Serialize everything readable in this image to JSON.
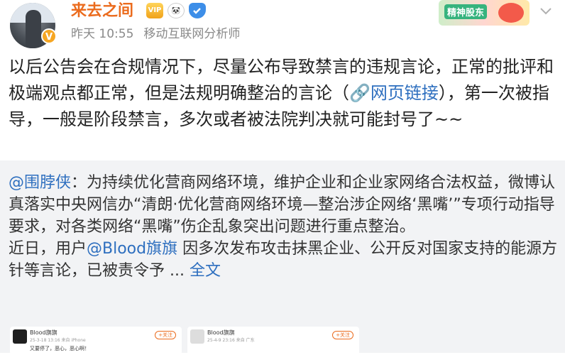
{
  "header": {
    "username": "来去之间",
    "verified_badge": "V",
    "badges": [
      {
        "name": "vip-badge",
        "label": "VIP"
      },
      {
        "name": "panda-badge",
        "label": "🐼"
      },
      {
        "name": "shield-badge",
        "label": ""
      }
    ],
    "time": "昨天 10:55",
    "source": "移动互联网分析师",
    "banner_text": "精神股东"
  },
  "post": {
    "text_before_link": "以后公告会在合规情况下，尽量公布导致禁言的违规言论，正常的批评和极端观点都正常，但是法规明确整治的言论（",
    "link_icon": "🔗",
    "link_text": "网页链接",
    "text_after_link": "），第一次被指导，一般是阶段禁言，多次或者被法院判决就可能封号了~~"
  },
  "repost": {
    "author_mention": "@围脖侠",
    "paragraph1": "：为持续优化营商网络环境，维护企业和企业家网络合法权益，微博认真落实中央网信办“清朗·优化营商网络环境—整治涉企网络‘黑嘴’”专项行动指导要求，对各类网络“黑嘴”伤企乱象突出问题进行重点整治。",
    "p2_before": "近日，用户",
    "p2_mention": "@Blood旗旗",
    "p2_after": " 因多次发布攻击抹黑企业、公开反对国家支持的能源方针等言论，已被责令予 ... ",
    "full_text": "全文"
  },
  "thumbnails": [
    {
      "name": "Blood旗旗",
      "meta": "25-3-18 13:16 来自 iPhone",
      "follow": "+关注",
      "body": "又要停了，恶心，恶心啊！"
    },
    {
      "name": "Blood旗旗",
      "meta": "25-4-9 23:16 来自 广东",
      "follow": "+关注",
      "body": ""
    }
  ],
  "colors": {
    "username": "#eb6b1d",
    "link": "#2e6fbf",
    "repost_bg": "#f2f3f5"
  }
}
